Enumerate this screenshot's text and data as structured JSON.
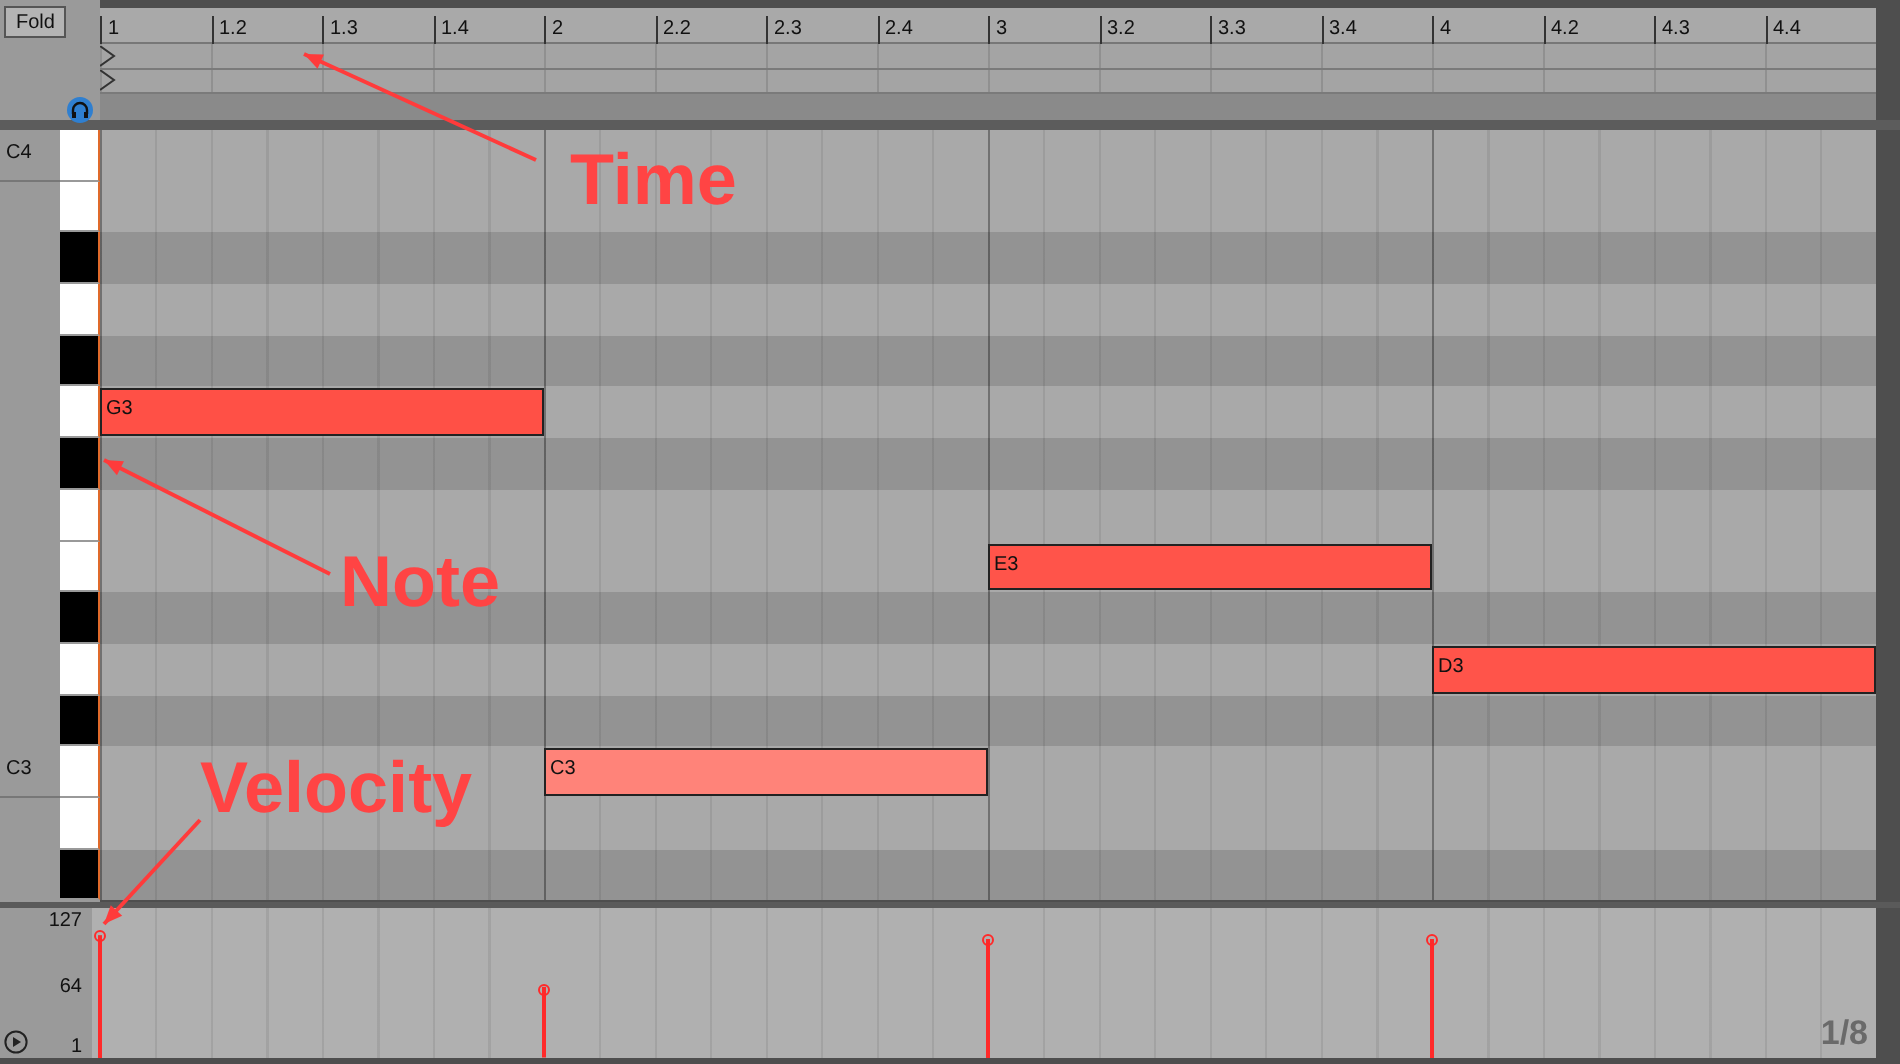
{
  "fold_button": {
    "label": "Fold"
  },
  "ruler": {
    "labels": [
      "1",
      "1.2",
      "1.3",
      "1.4",
      "2",
      "2.2",
      "2.3",
      "2.4",
      "3",
      "3.2",
      "3.3",
      "3.4",
      "4",
      "4.2",
      "4.3",
      "4.4"
    ]
  },
  "rows": [
    {
      "kind": "white",
      "key_label": "C4"
    },
    {
      "kind": "white"
    },
    {
      "kind": "black"
    },
    {
      "kind": "white"
    },
    {
      "kind": "black"
    },
    {
      "kind": "white",
      "notes": [
        {
          "label": "G3",
          "kind": "first",
          "level": 0.86
        }
      ]
    },
    {
      "kind": "black"
    },
    {
      "kind": "white"
    },
    {
      "kind": "white",
      "notes": [
        {
          "label": "E3",
          "kind": "third",
          "level": 0.83
        }
      ]
    },
    {
      "kind": "black"
    },
    {
      "kind": "white",
      "notes": [
        {
          "label": "D3",
          "kind": "fourth",
          "level": 0.83
        }
      ]
    },
    {
      "kind": "black"
    },
    {
      "kind": "white",
      "key_label": "C3",
      "notes": [
        {
          "label": "C3",
          "kind": "second",
          "level": 0.49
        }
      ]
    },
    {
      "kind": "white"
    },
    {
      "kind": "black"
    }
  ],
  "velocity": {
    "scale": [
      "127",
      "64",
      "1"
    ],
    "grid": "1/8"
  },
  "annotations": [
    {
      "kind": "time",
      "label": "Time"
    },
    {
      "kind": "note",
      "label": "Note"
    },
    {
      "kind": "velocity",
      "label": "Velocity"
    }
  ]
}
